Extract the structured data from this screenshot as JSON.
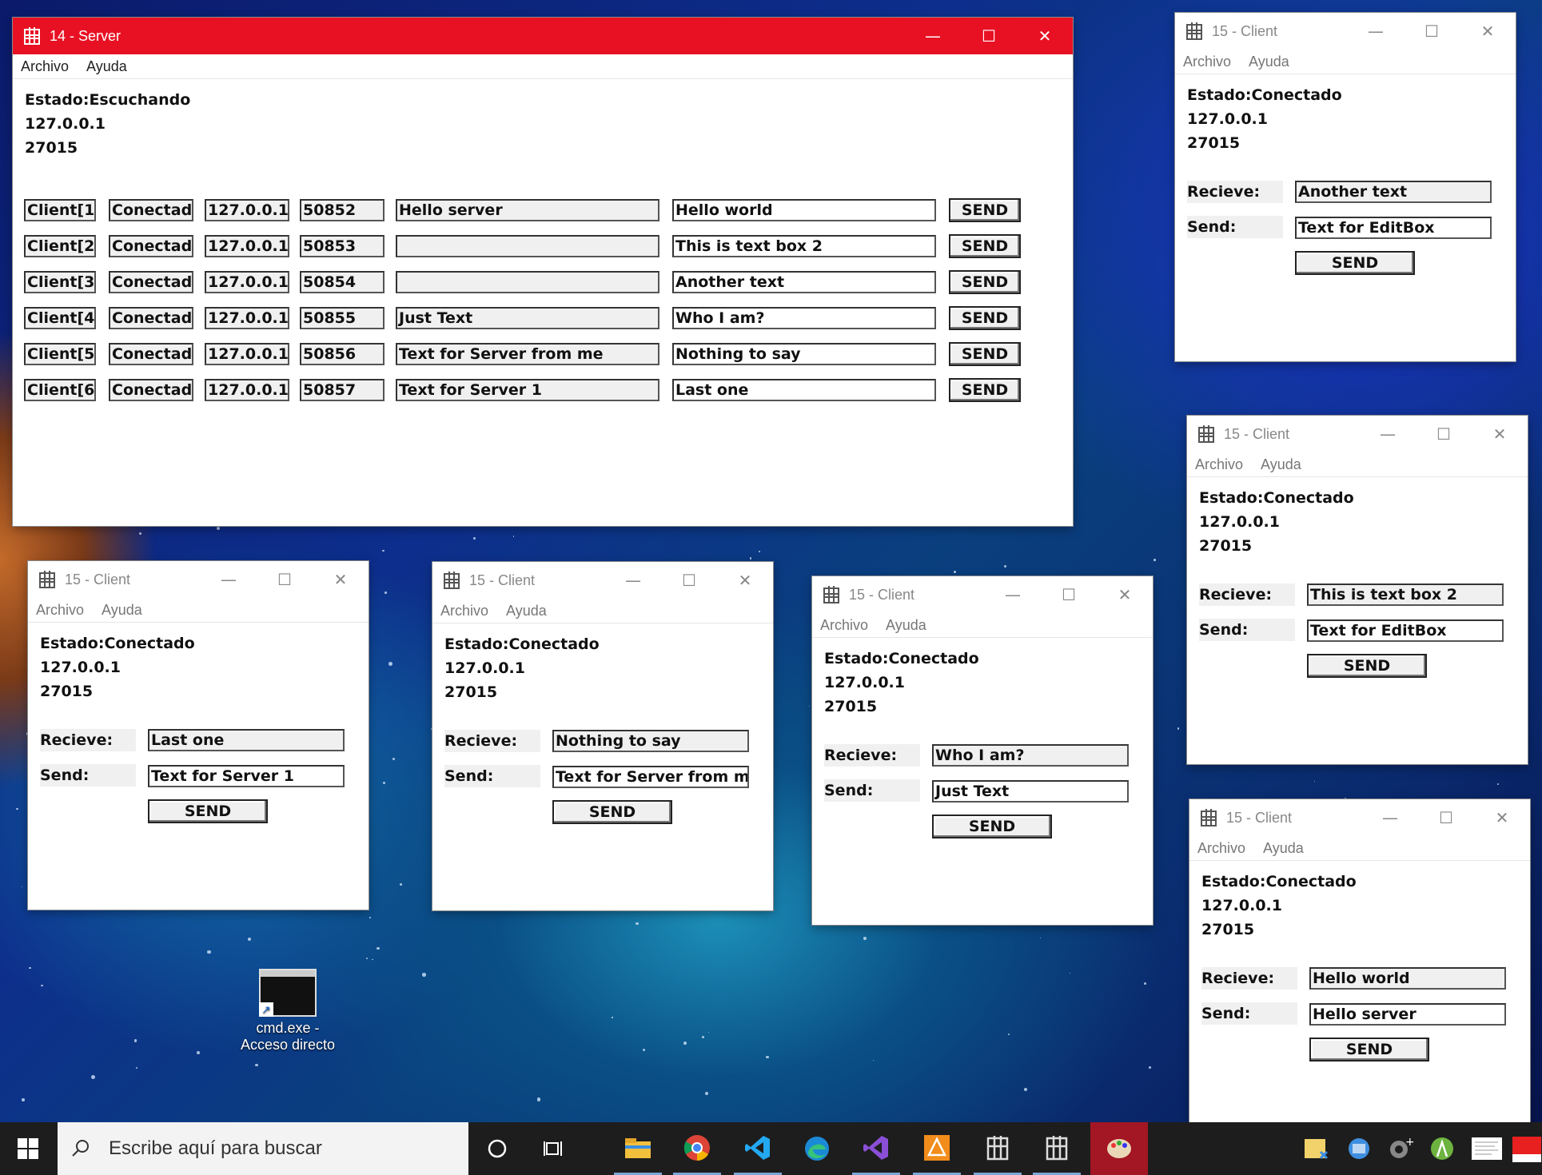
{
  "server": {
    "title": "14 - Server",
    "menu": [
      "Archivo",
      "Ayuda"
    ],
    "status": "Estado:Escuchando",
    "ip": "127.0.0.1",
    "port": "27015",
    "rows": [
      {
        "client": "Client[1]",
        "state": "Conectado",
        "ip": "127.0.0.1",
        "port": "50852",
        "recv": "Hello server",
        "send": "Hello world",
        "button": "SEND"
      },
      {
        "client": "Client[2]",
        "state": "Conectado",
        "ip": "127.0.0.1",
        "port": "50853",
        "recv": "",
        "send": "This is text box 2",
        "button": "SEND"
      },
      {
        "client": "Client[3]",
        "state": "Conectado",
        "ip": "127.0.0.1",
        "port": "50854",
        "recv": "",
        "send": "Another text",
        "button": "SEND"
      },
      {
        "client": "Client[4]",
        "state": "Conectado",
        "ip": "127.0.0.1",
        "port": "50855",
        "recv": "Just Text",
        "send": "Who I am?",
        "button": "SEND"
      },
      {
        "client": "Client[5]",
        "state": "Conectado",
        "ip": "127.0.0.1",
        "port": "50856",
        "recv": "Text for Server from me",
        "send": "Nothing to say",
        "button": "SEND"
      },
      {
        "client": "Client[6]",
        "state": "Conectado",
        "ip": "127.0.0.1",
        "port": "50857",
        "recv": "Text for Server 1",
        "send": "Last one",
        "button": "SEND"
      }
    ]
  },
  "client_window": {
    "title": "15 - Client",
    "menu": [
      "Archivo",
      "Ayuda"
    ],
    "status": "Estado:Conectado",
    "ip": "127.0.0.1",
    "port": "27015",
    "recv_label": "Recieve:",
    "send_label": "Send:",
    "button": "SEND"
  },
  "clients": [
    {
      "recv": "Another text",
      "send": "Text for EditBox"
    },
    {
      "recv": "This is text box 2",
      "send": "Text for EditBox"
    },
    {
      "recv": "Hello world",
      "send": "Hello server"
    },
    {
      "recv": "Last one",
      "send": "Text for Server 1"
    },
    {
      "recv": "Nothing to say",
      "send": "Text for Server from me"
    },
    {
      "recv": "Who I am?",
      "send": "Just Text"
    }
  ],
  "desktop": {
    "shortcut_label_1": "cmd.exe -",
    "shortcut_label_2": "Acceso directo"
  },
  "taskbar": {
    "search_placeholder": "Escribe aquí para buscar",
    "apps": [
      "start-icon",
      "cortana-icon",
      "task-view-icon",
      "file-explorer-icon",
      "chrome-icon",
      "vscode-icon",
      "edge-icon",
      "visual-studio-icon",
      "app-orange-icon",
      "client-app-icon",
      "client-app-icon",
      "paint-icon"
    ]
  },
  "colors": {
    "server_titlebar": "#e81123",
    "taskbar": "#1d1d1d"
  }
}
